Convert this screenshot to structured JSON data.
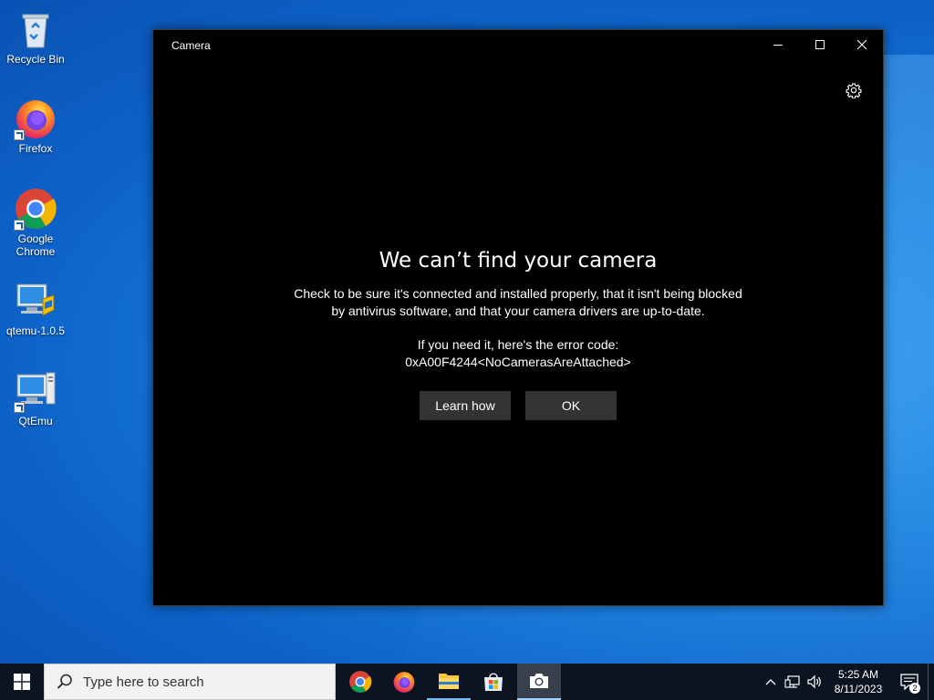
{
  "desktop": {
    "icons": [
      {
        "label": "Recycle Bin",
        "icon": "recycle-bin-icon"
      },
      {
        "label": "Firefox",
        "icon": "firefox-icon"
      },
      {
        "label": "Google Chrome",
        "icon": "chrome-icon"
      },
      {
        "label": "qtemu-1.0.5",
        "icon": "computer-icon"
      },
      {
        "label": "QtEmu",
        "icon": "computer-icon"
      }
    ]
  },
  "window": {
    "title": "Camera",
    "controls": [
      "minimize-icon",
      "maximize-icon",
      "close-icon"
    ],
    "settings_icon": "gear-icon",
    "error": {
      "heading": "We can’t find your camera",
      "line1": "Check to be sure it's connected and installed properly, that it isn't being blocked",
      "line2": "by antivirus software, and that your camera drivers are up-to-date.",
      "code_intro": "If you need it, here's the error code:",
      "code": "0xA00F4244<NoCamerasAreAttached>"
    },
    "buttons": {
      "learn_how": "Learn how",
      "ok": "OK"
    }
  },
  "taskbar": {
    "search_placeholder": "Type here to search",
    "apps": [
      {
        "name": "Google Chrome",
        "icon": "chrome-icon"
      },
      {
        "name": "Firefox",
        "icon": "firefox-icon"
      },
      {
        "name": "File Explorer",
        "icon": "folder-icon"
      },
      {
        "name": "Microsoft Store",
        "icon": "store-icon"
      },
      {
        "name": "Camera",
        "icon": "camera-icon"
      }
    ],
    "clock": {
      "time": "5:25 AM",
      "date": "8/11/2023"
    },
    "notification_count": "2",
    "colors": {
      "taskbar_bg": "#0b1420",
      "accent": "#76b9ed"
    }
  }
}
